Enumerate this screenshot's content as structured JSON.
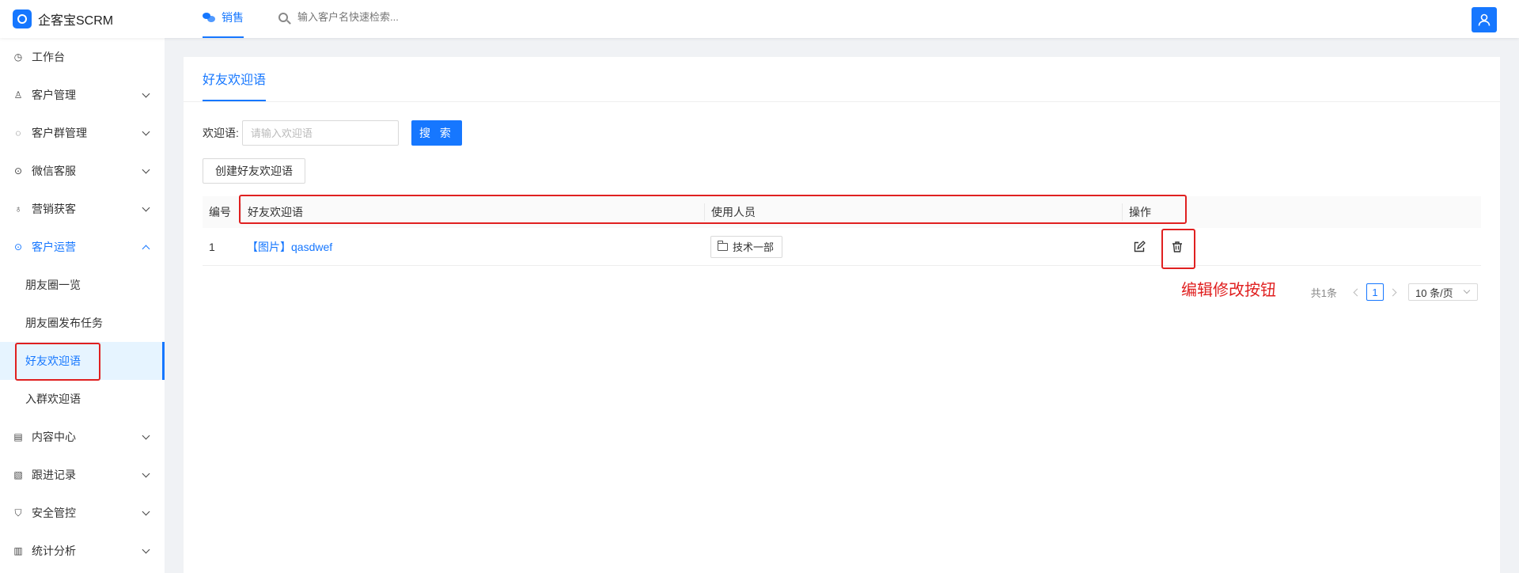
{
  "app": {
    "name": "企客宝SCRM"
  },
  "topnav": {
    "active_tab": "销售",
    "search_placeholder": "输入客户名快速检索..."
  },
  "sidebar": {
    "items": [
      {
        "label": "工作台",
        "icon": "dashboard-icon"
      },
      {
        "label": "客户管理",
        "icon": "user-icon"
      },
      {
        "label": "客户群管理",
        "icon": "chat-icon"
      },
      {
        "label": "微信客服",
        "icon": "service-icon"
      },
      {
        "label": "营销获客",
        "icon": "bulb-icon"
      },
      {
        "label": "客户运营",
        "icon": "operation-icon"
      },
      {
        "label": "内容中心",
        "icon": "content-icon"
      },
      {
        "label": "跟进记录",
        "icon": "record-icon"
      },
      {
        "label": "安全管控",
        "icon": "shield-icon"
      },
      {
        "label": "统计分析",
        "icon": "chart-icon"
      }
    ],
    "sub_items": [
      "朋友圈一览",
      "朋友圈发布任务",
      "好友欢迎语",
      "入群欢迎语"
    ]
  },
  "page": {
    "tab": "好友欢迎语",
    "filter_label": "欢迎语:",
    "filter_placeholder": "请输入欢迎语",
    "search_button": "搜 索",
    "create_button": "创建好友欢迎语"
  },
  "table": {
    "columns": [
      "编号",
      "好友欢迎语",
      "使用人员",
      "操作"
    ],
    "rows": [
      {
        "no": "1",
        "message": "【图片】qasdwef",
        "user": "技术一部"
      }
    ]
  },
  "pagination": {
    "total": "共1条",
    "current_page": "1",
    "page_size": "10 条/页"
  },
  "annotation": {
    "note": "编辑修改按钮",
    "color": "#e02020"
  },
  "colors": {
    "accent": "#1677ff"
  }
}
